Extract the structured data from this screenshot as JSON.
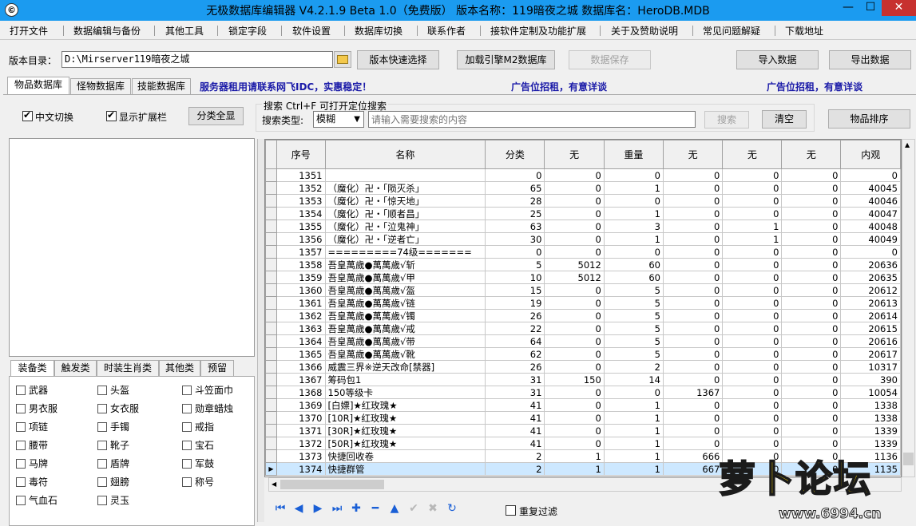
{
  "window": {
    "title": "无极数据库编辑器 V4.2.1.9   Beta 1.0（免费版）   版本名称：119暗夜之城    数据库名：HeroDB.MDB",
    "min": "—",
    "max": "☐",
    "close": "✕"
  },
  "menu": [
    "打开文件",
    "数据编辑与备份",
    "其他工具",
    "锁定字段",
    "软件设置",
    "数据库切换",
    "联系作者",
    "接软件定制及功能扩展",
    "关于及赞助说明",
    "常见问题解疑",
    "下载地址"
  ],
  "toolbar": {
    "version_dir_label": "版本目录：",
    "version_dir_value": "D:\\Mirserver119暗夜之城",
    "quick_select": "版本快速选择",
    "load_engine": "加载引擎M2数据库",
    "save_data": "数据保存",
    "import_data": "导入数据",
    "export_data": "导出数据"
  },
  "tabs": [
    "物品数据库",
    "怪物数据库",
    "技能数据库"
  ],
  "ads": [
    "服务器租用请联系网飞IDC，实惠稳定！",
    "广告位招租，有意详谈",
    "广告位招租，有意详谈"
  ],
  "options": {
    "chinese_switch": "中文切换",
    "show_ext": "显示扩展栏",
    "show_all_cats": "分类全显"
  },
  "search": {
    "title": "搜索   Ctrl+F 可打开定位搜索",
    "type_label": "搜索类型:",
    "type_value": "模糊",
    "placeholder": "请输入需要搜索的内容",
    "search_btn": "搜索",
    "clear_btn": "清空",
    "sort_btn": "物品排序"
  },
  "category_tabs": [
    "装备类",
    "触发类",
    "时装生肖类",
    "其他类",
    "预留"
  ],
  "categories": [
    [
      "武器",
      "头盔",
      "斗笠面巾"
    ],
    [
      "男衣服",
      "女衣服",
      "勋章蜡烛"
    ],
    [
      "项链",
      "手镯",
      "戒指"
    ],
    [
      "腰带",
      "靴子",
      "宝石"
    ],
    [
      "马牌",
      "盾牌",
      "军鼓"
    ],
    [
      "毒符",
      "翅膀",
      "称号"
    ],
    [
      "气血石",
      "灵玉",
      ""
    ]
  ],
  "grid": {
    "columns": [
      "序号",
      "名称",
      "分类",
      "无",
      "重量",
      "无",
      "无",
      "无",
      "内观"
    ],
    "rows": [
      [
        "1351",
        "",
        "0",
        "0",
        "0",
        "0",
        "0",
        "0",
        "0"
      ],
      [
        "1352",
        "（魔化）卍・「陨灭杀」",
        "65",
        "0",
        "1",
        "0",
        "0",
        "0",
        "40045"
      ],
      [
        "1353",
        "（魔化）卍・「惊天地」",
        "28",
        "0",
        "0",
        "0",
        "0",
        "0",
        "40046"
      ],
      [
        "1354",
        "（魔化）卍・「顺者昌」",
        "25",
        "0",
        "1",
        "0",
        "0",
        "0",
        "40047"
      ],
      [
        "1355",
        "（魔化）卍・「泣鬼神」",
        "63",
        "0",
        "3",
        "0",
        "1",
        "0",
        "40048"
      ],
      [
        "1356",
        "（魔化）卍・「逆者亡」",
        "30",
        "0",
        "1",
        "0",
        "1",
        "0",
        "40049"
      ],
      [
        "1357",
        "=========74级=======",
        "0",
        "0",
        "0",
        "0",
        "0",
        "0",
        "0"
      ],
      [
        "1358",
        "吾皇萬歲●萬萬歲√斩",
        "5",
        "5012",
        "60",
        "0",
        "0",
        "0",
        "20636"
      ],
      [
        "1359",
        "吾皇萬歲●萬萬歲√甲",
        "10",
        "5012",
        "60",
        "0",
        "0",
        "0",
        "20635"
      ],
      [
        "1360",
        "吾皇萬歲●萬萬歲√盔",
        "15",
        "0",
        "5",
        "0",
        "0",
        "0",
        "20612"
      ],
      [
        "1361",
        "吾皇萬歲●萬萬歲√链",
        "19",
        "0",
        "5",
        "0",
        "0",
        "0",
        "20613"
      ],
      [
        "1362",
        "吾皇萬歲●萬萬歲√镯",
        "26",
        "0",
        "5",
        "0",
        "0",
        "0",
        "20614"
      ],
      [
        "1363",
        "吾皇萬歲●萬萬歲√戒",
        "22",
        "0",
        "5",
        "0",
        "0",
        "0",
        "20615"
      ],
      [
        "1364",
        "吾皇萬歲●萬萬歲√带",
        "64",
        "0",
        "5",
        "0",
        "0",
        "0",
        "20616"
      ],
      [
        "1365",
        "吾皇萬歲●萬萬歲√靴",
        "62",
        "0",
        "5",
        "0",
        "0",
        "0",
        "20617"
      ],
      [
        "1366",
        "威震三界※逆天改命[禁器]",
        "26",
        "0",
        "2",
        "0",
        "0",
        "0",
        "10317"
      ],
      [
        "1367",
        "筹码包1",
        "31",
        "150",
        "14",
        "0",
        "0",
        "0",
        "390"
      ],
      [
        "1368",
        "150等级卡",
        "31",
        "0",
        "0",
        "1367",
        "0",
        "0",
        "10054"
      ],
      [
        "1369",
        "[白嫖]★红玫瑰★",
        "41",
        "0",
        "1",
        "0",
        "0",
        "0",
        "1338"
      ],
      [
        "1370",
        "[10R]★红玫瑰★",
        "41",
        "0",
        "1",
        "0",
        "0",
        "0",
        "1338"
      ],
      [
        "1371",
        "[30R]★红玫瑰★",
        "41",
        "0",
        "1",
        "0",
        "0",
        "0",
        "1339"
      ],
      [
        "1372",
        "[50R]★红玫瑰★",
        "41",
        "0",
        "1",
        "0",
        "0",
        "0",
        "1339"
      ],
      [
        "1373",
        "快捷回收卷",
        "2",
        "1",
        "1",
        "666",
        "0",
        "0",
        "1136"
      ],
      [
        "1374",
        "快捷群管",
        "2",
        "1",
        "1",
        "667",
        "0",
        "0",
        "1135"
      ]
    ],
    "selected_row": 23
  },
  "nav": {
    "first": "⏮",
    "prev": "◀",
    "next": "▶",
    "last": "⏭",
    "add": "✚",
    "delete": "━",
    "up": "▲",
    "confirm": "✔",
    "cancel": "✖",
    "refresh": "↻",
    "dedupe_label": "重复过滤"
  },
  "watermark": {
    "text": "萝卜论坛",
    "url": "www.6994.cn"
  },
  "colors": {
    "titlebar": "#1b9bf0",
    "close": "#c7312f",
    "ad": "#1a1aa8",
    "selected": "#cde8ff"
  }
}
